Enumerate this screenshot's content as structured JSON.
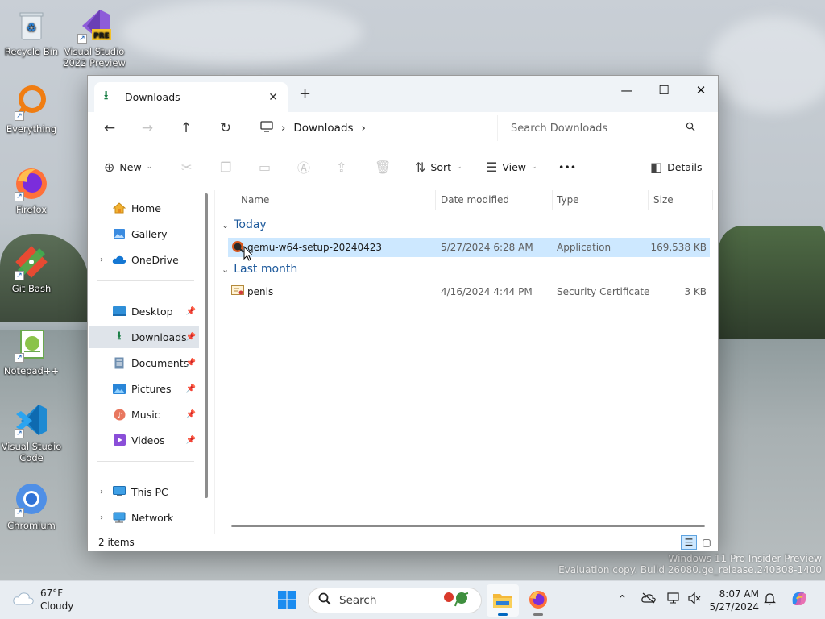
{
  "desktop": {
    "icons": [
      {
        "label": "Recycle Bin"
      },
      {
        "label": "Visual Studio 2022 Preview",
        "badge": "PRE"
      },
      {
        "label": "Everything"
      },
      {
        "label": "Firefox"
      },
      {
        "label": "Git Bash"
      },
      {
        "label": "Notepad++"
      },
      {
        "label": "Visual Studio Code"
      },
      {
        "label": "Chromium"
      }
    ],
    "watermark": {
      "line1": "Windows 11 Pro Insider Preview",
      "line2": "Evaluation copy. Build 26080.ge_release.240308-1400"
    }
  },
  "window": {
    "tab": {
      "label": "Downloads",
      "close": "✕"
    },
    "new_tab": "+",
    "controls": {
      "minimize": "—",
      "maximize": "☐",
      "close": "✕"
    },
    "nav": {
      "back": "←",
      "forward": "→",
      "up": "↑",
      "refresh": "↻"
    },
    "address": {
      "separator": "›",
      "crumb": "Downloads"
    },
    "search": {
      "placeholder": "Search Downloads"
    },
    "toolbar": {
      "new_label": "New",
      "sort_label": "Sort",
      "view_label": "View",
      "more_label": "•••",
      "details_label": "Details"
    },
    "sidebar": {
      "items": [
        {
          "label": "Home"
        },
        {
          "label": "Gallery"
        },
        {
          "label": "OneDrive"
        },
        {
          "label": "Desktop"
        },
        {
          "label": "Downloads"
        },
        {
          "label": "Documents"
        },
        {
          "label": "Pictures"
        },
        {
          "label": "Music"
        },
        {
          "label": "Videos"
        },
        {
          "label": "This PC"
        },
        {
          "label": "Network"
        }
      ]
    },
    "columns": {
      "name": "Name",
      "date": "Date modified",
      "type": "Type",
      "size": "Size"
    },
    "groups": [
      {
        "label": "Today",
        "files": [
          {
            "name": "qemu-w64-setup-20240423",
            "date": "5/27/2024 6:28 AM",
            "type": "Application",
            "size": "169,538 KB"
          }
        ]
      },
      {
        "label": "Last month",
        "files": [
          {
            "name": "penis",
            "date": "4/16/2024 4:44 PM",
            "type": "Security Certificate",
            "size": "3 KB"
          }
        ]
      }
    ],
    "status": {
      "count": "2 items"
    }
  },
  "taskbar": {
    "weather": {
      "temp": "67°F",
      "condition": "Cloudy"
    },
    "search_label": "Search",
    "clock": {
      "time": "8:07 AM",
      "date": "5/27/2024"
    }
  },
  "colors": {
    "accent": "#0067c0",
    "selection": "#cde8ff",
    "group_header": "#1e5a9c"
  }
}
